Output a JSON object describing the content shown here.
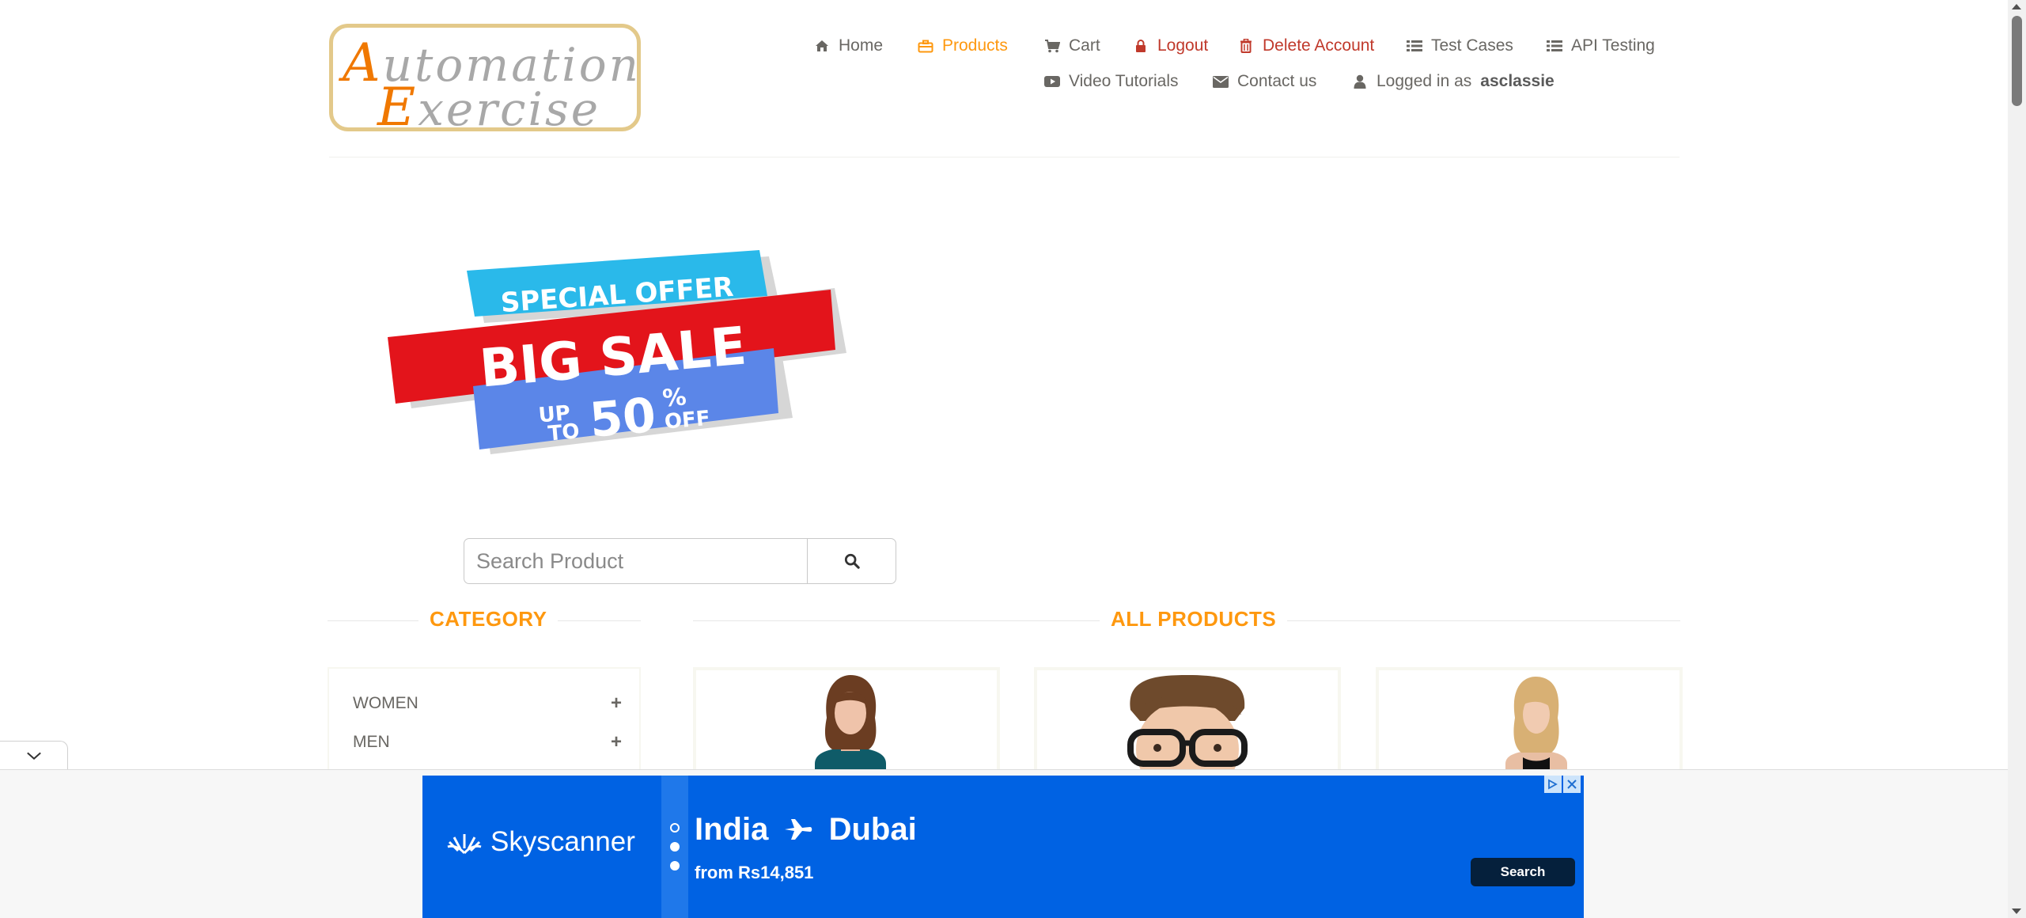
{
  "logo": {
    "line1_cap": "A",
    "line1_rest": "utomation",
    "line2_cap": "E",
    "line2_rest": "xercise"
  },
  "nav": {
    "home": "Home",
    "products": "Products",
    "cart": "Cart",
    "logout": "Logout",
    "delete_account": "Delete Account",
    "test_cases": "Test Cases",
    "api_testing": "API Testing",
    "video_tutorials": "Video Tutorials",
    "contact_us": "Contact us",
    "logged_in_prefix": "Logged in as",
    "username": "asclassie"
  },
  "banner": {
    "line1": "SPECIAL OFFER",
    "line2": "BIG SALE",
    "up": "UP",
    "to": "TO",
    "percent_value": "50",
    "percent_sign": "%",
    "off": "OFF"
  },
  "search": {
    "placeholder": "Search Product"
  },
  "sections": {
    "category": "CATEGORY",
    "all_products": "ALL PRODUCTS"
  },
  "categories": [
    {
      "label": "WOMEN",
      "toggle": "+"
    },
    {
      "label": "MEN",
      "toggle": "+"
    }
  ],
  "ad": {
    "brand": "Skyscanner",
    "route_from": "India",
    "route_to": "Dubai",
    "price": "from Rs14,851",
    "cta": "Search"
  },
  "colors": {
    "accent": "#fe980f",
    "danger": "#c0392b",
    "ad_blue": "#0062e3",
    "ad_button": "#05203c"
  },
  "icons": {
    "home": "home-icon",
    "products": "briefcase-icon",
    "cart": "cart-icon",
    "logout": "lock-icon",
    "delete": "trash-icon",
    "test_cases": "list-icon",
    "api": "list-icon",
    "video": "youtube-play-icon",
    "contact": "envelope-icon",
    "user": "user-icon",
    "search": "search-icon",
    "collapse": "chevron-down-icon"
  }
}
